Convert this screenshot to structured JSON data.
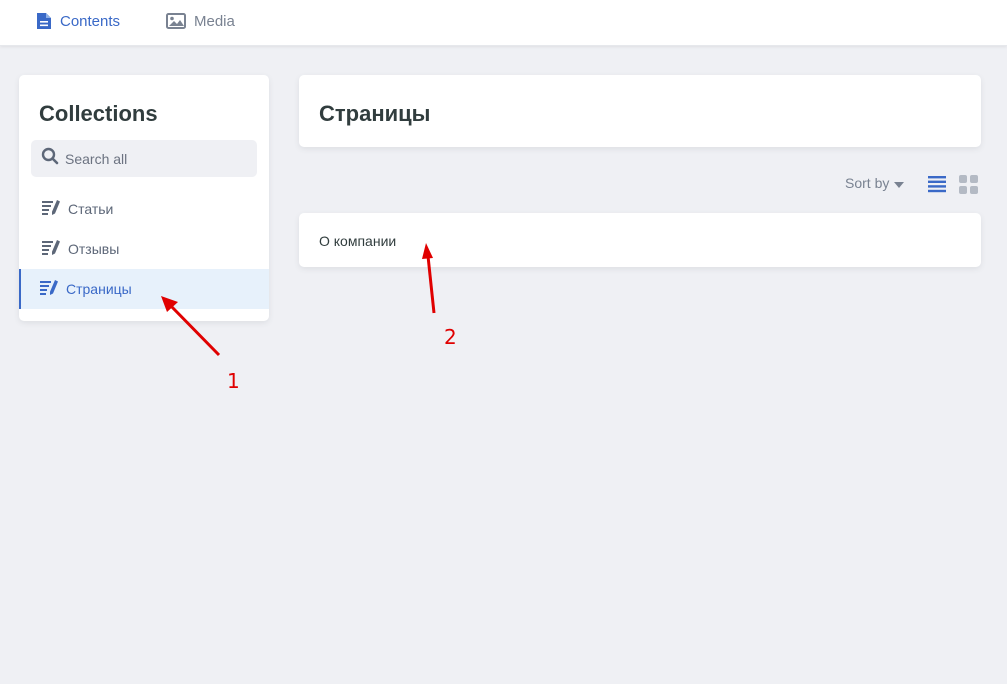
{
  "topnav": {
    "items": [
      {
        "label": "Contents",
        "icon": "document-icon",
        "active": true
      },
      {
        "label": "Media",
        "icon": "image-icon",
        "active": false
      }
    ]
  },
  "sidebar": {
    "title": "Collections",
    "search_placeholder": "Search all",
    "items": [
      {
        "label": "Статьи",
        "icon": "collection-edit-icon",
        "active": false
      },
      {
        "label": "Отзывы",
        "icon": "collection-edit-icon",
        "active": false
      },
      {
        "label": "Страницы",
        "icon": "collection-edit-icon",
        "active": true
      }
    ]
  },
  "main": {
    "title": "Страницы",
    "sort_label": "Sort by",
    "entries": [
      {
        "title": "О компании"
      }
    ]
  },
  "annotations": [
    {
      "label": "1"
    },
    {
      "label": "2"
    }
  ],
  "colors": {
    "accent": "#3a69c7",
    "background": "#eff0f4",
    "active_bg": "#e7f1fb",
    "annotation": "#e00000"
  }
}
